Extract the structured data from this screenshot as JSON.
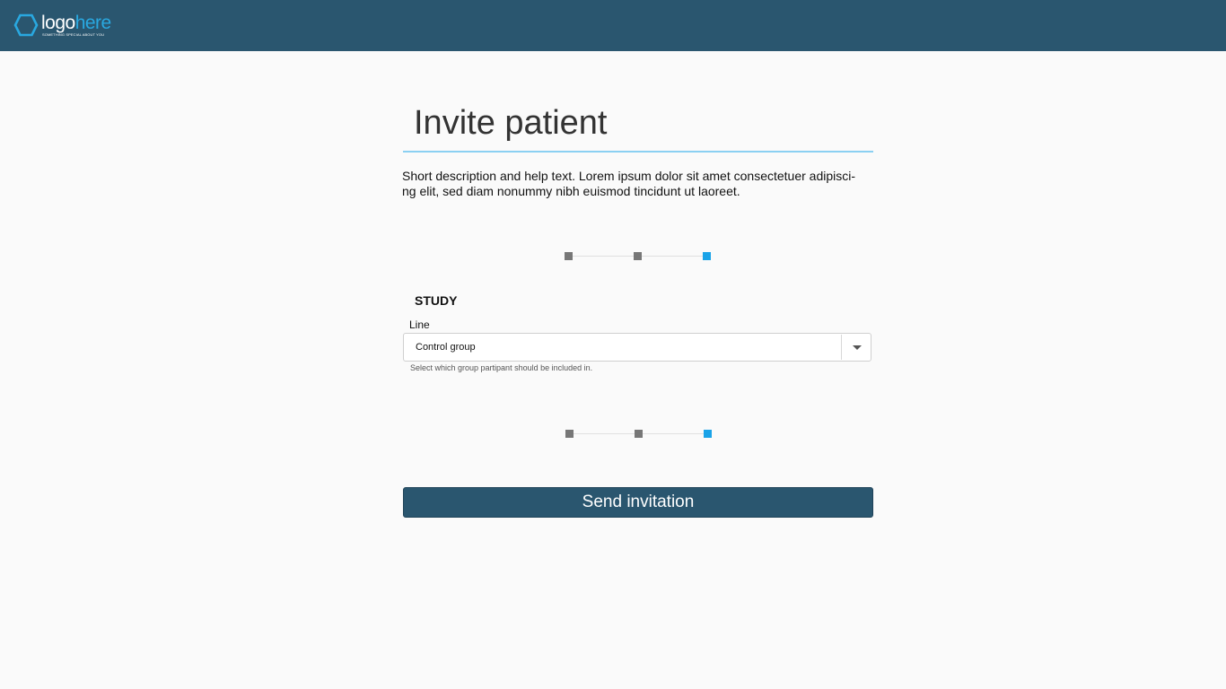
{
  "header": {
    "logo": {
      "word_main": "logo",
      "word_accent": "here",
      "tagline": "SOMETHING SPECIAL ABOUT YOU",
      "icon": "hexagon-icon"
    }
  },
  "form": {
    "title": "Invite patient",
    "description": "Short description and help text. Lorem ipsum dolor sit amet consectetuer adipisci-ng elit, sed diam nonummy nibh euismod tincidunt ut laoreet.",
    "stepper_top": {
      "steps": 3,
      "current": 3
    },
    "section_title": "STUDY",
    "line_field": {
      "label": "Line",
      "value": "Control group",
      "helper": "Select which group partipant should be included in.",
      "icon": "chevron-down-icon"
    },
    "stepper_bottom": {
      "steps": 3,
      "current": 3
    },
    "submit_label": "Send invitation"
  },
  "colors": {
    "header_bg": "#2a566f",
    "accent": "#29a8e0",
    "active_step": "#1aa3e8",
    "inactive_step": "#777777",
    "button_bg": "#2a566f",
    "title_rule": "#8bd0f2"
  }
}
